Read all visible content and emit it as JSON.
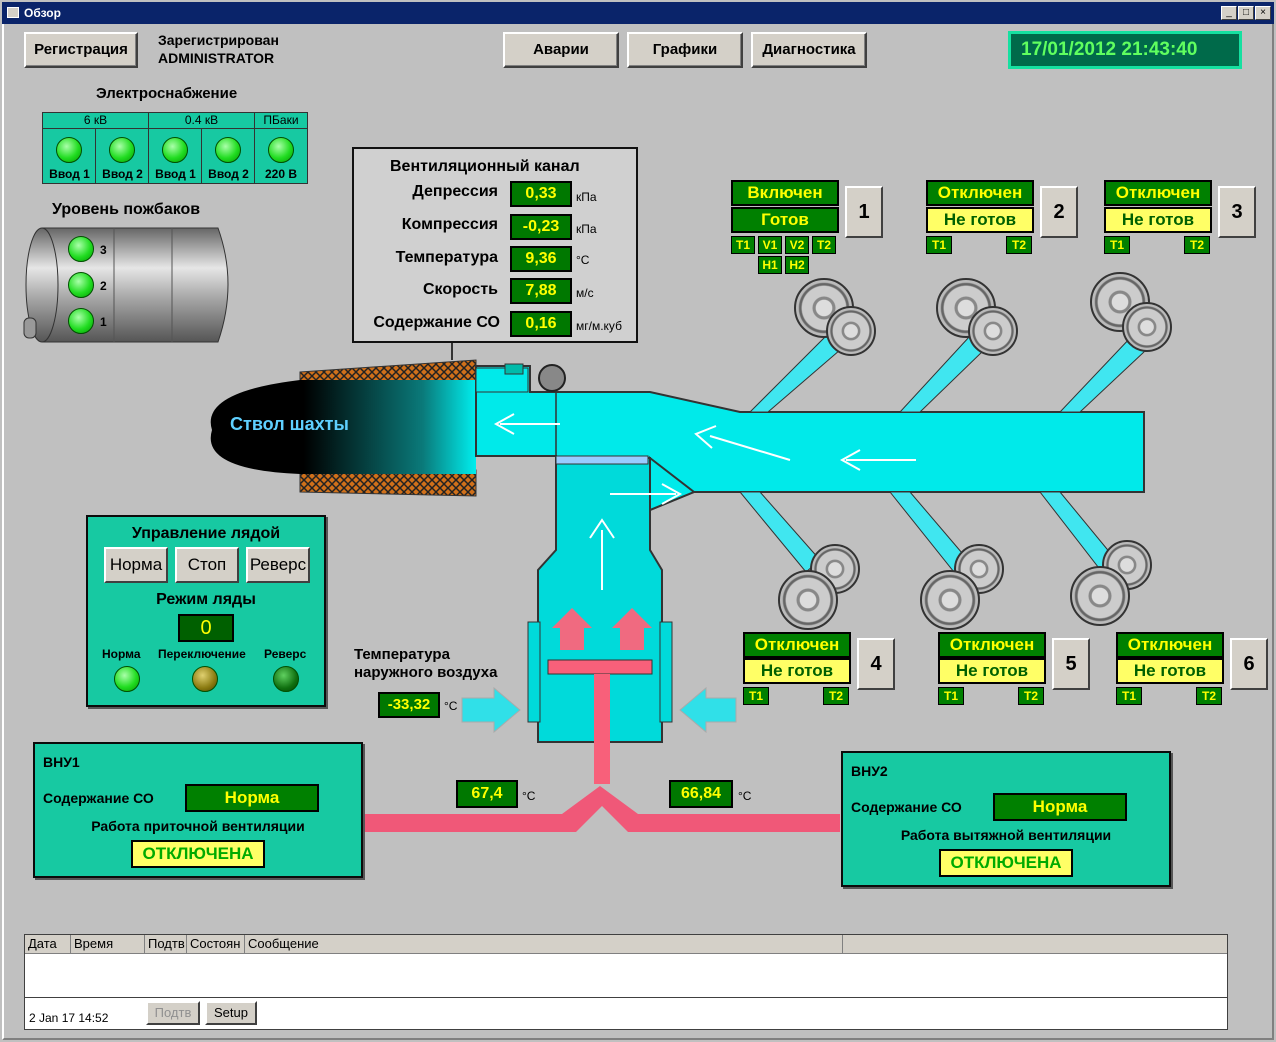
{
  "window": {
    "title": "Обзор",
    "minimize": "_",
    "maximize": "□",
    "close": "×"
  },
  "header": {
    "registration_btn": "Регистрация",
    "registered_line1": "Зарегистрирован",
    "registered_line2": "ADMINISTRATOR",
    "alarms_btn": "Аварии",
    "graphs_btn": "Графики",
    "diagnostics_btn": "Диагностика",
    "datetime": "17/01/2012 21:43:40"
  },
  "power": {
    "title": "Электроснабжение",
    "groups": [
      "6 кВ",
      "0.4 кВ",
      "ПБаки"
    ],
    "inputs": [
      "Ввод 1",
      "Ввод 2",
      "Ввод 1",
      "Ввод 2",
      "220 В"
    ]
  },
  "tanks": {
    "title": "Уровень пожбаков",
    "levels": [
      "3",
      "2",
      "1"
    ]
  },
  "vent_channel": {
    "title": "Вентиляционный канал",
    "rows": [
      {
        "label": "Депрессия",
        "value": "0,33",
        "unit": "кПа"
      },
      {
        "label": "Компрессия",
        "value": "-0,23",
        "unit": "кПа"
      },
      {
        "label": "Температура",
        "value": "9,36",
        "unit": "°С"
      },
      {
        "label": "Скорость",
        "value": "7,88",
        "unit": "м/с"
      },
      {
        "label": "Содержание СО",
        "value": "0,16",
        "unit": "мг/м.куб"
      }
    ]
  },
  "shaft_label": "Ствол шахты",
  "fans": [
    {
      "num": "1",
      "status": "Включен",
      "ready": "Готов",
      "tags": [
        "T1",
        "V1",
        "V2",
        "T2",
        "H1",
        "H2"
      ]
    },
    {
      "num": "2",
      "status": "Отключен",
      "ready": "Не готов",
      "tags": [
        "T1",
        "T2"
      ]
    },
    {
      "num": "3",
      "status": "Отключен",
      "ready": "Не готов",
      "tags": [
        "T1",
        "T2"
      ]
    },
    {
      "num": "4",
      "status": "Отключен",
      "ready": "Не готов",
      "tags": [
        "T1",
        "T2"
      ]
    },
    {
      "num": "5",
      "status": "Отключен",
      "ready": "Не готов",
      "tags": [
        "T1",
        "T2"
      ]
    },
    {
      "num": "6",
      "status": "Отключен",
      "ready": "Не готов",
      "tags": [
        "T1",
        "T2"
      ]
    }
  ],
  "hatch": {
    "title": "Управление лядой",
    "buttons": [
      "Норма",
      "Стоп",
      "Реверс"
    ],
    "mode_title": "Режим ляды",
    "mode_value": "0",
    "indicators": [
      "Норма",
      "Переключение",
      "Реверс"
    ]
  },
  "outside": {
    "label_line1": "Температура",
    "label_line2": "наружного воздуха",
    "value": "-33,32",
    "unit": "°С"
  },
  "pipes": {
    "left_value": "67,4",
    "right_value": "66,84",
    "unit": "°С"
  },
  "vnu1": {
    "title": "ВНУ1",
    "co_label": "Содержание СО",
    "co_value": "Норма",
    "work_label": "Работа приточной вентиляции",
    "work_value": "ОТКЛЮЧЕНА"
  },
  "vnu2": {
    "title": "ВНУ2",
    "co_label": "Содержание СО",
    "co_value": "Норма",
    "work_label": "Работа вытяжной вентиляции",
    "work_value": "ОТКЛЮЧЕНА"
  },
  "alarm_table": {
    "columns": [
      "Дата",
      "Время",
      "Подтв",
      "Состоян",
      "Сообщение"
    ],
    "footer_time": "2 Jan 17 14:52",
    "ack_btn": "Подтв",
    "setup_btn": "Setup"
  }
}
